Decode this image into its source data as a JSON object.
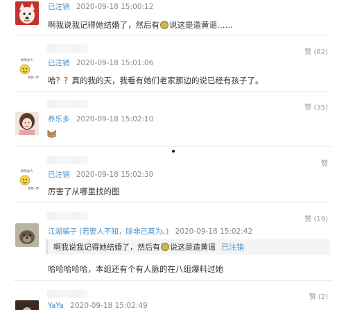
{
  "comments": [
    {
      "user": "已注销",
      "time": "2020-09-18 15:00:12",
      "text_before": "啊我说我记得她结婚了，然后有",
      "text_after": "说这是造黄谣……",
      "likes": "",
      "avatar_icon": "dog-avatar-icon"
    },
    {
      "user": "已注销",
      "time": "2020-09-18 15:01:06",
      "text": "哈？？真的我的天，我看有她们老家那边的说已经有孩子了。",
      "likes": "赞 (82)",
      "avatar_icon": "deleted-user-avatar-icon",
      "avatar_top": "你的女人",
      "avatar_bottom": "我就一梦"
    },
    {
      "user": "养乐多",
      "time": "2020-09-18 15:02:10",
      "likes": "赞 (35)",
      "avatar_icon": "girl-avatar-icon",
      "emoji_icon": "cat-emoji-icon"
    },
    {
      "user": "已注销",
      "time": "2020-09-18 15:02:30",
      "text": "厉害了从哪里找的图",
      "likes": "赞",
      "avatar_icon": "deleted-user-avatar-icon",
      "avatar_top": "你的女人",
      "avatar_bottom": "我就一梦"
    },
    {
      "user": "江湖骗子",
      "user_note": "(若要人不知，除非己莫为。)",
      "time": "2020-09-18 15:02:42",
      "likes": "赞 (19)",
      "avatar_icon": "otter-avatar-icon",
      "quote_before": "啊我说我记得她结婚了，然后有",
      "quote_after": "说这是造黄谣",
      "quote_user": "已注销",
      "text": "哈哈哈哈哈，本组还有个有人脉的在八组爆料过她"
    },
    {
      "user": "YaYa",
      "time": "2020-09-18 15:02:49",
      "likes": "赞 (2)",
      "avatar_icon": "dark-avatar-icon"
    }
  ],
  "colors": {
    "username": "#4a90c8",
    "time": "#888888",
    "likes": "#999999",
    "separator": "#ececec"
  }
}
